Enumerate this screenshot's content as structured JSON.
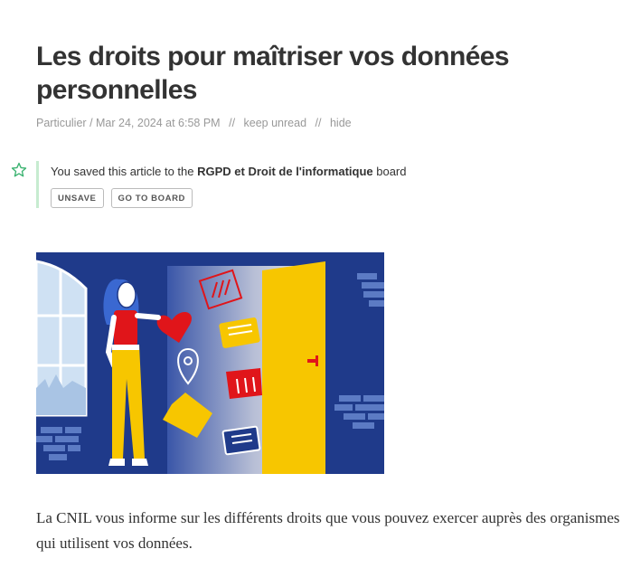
{
  "article": {
    "title": "Les droits pour maîtriser vos données personnelles",
    "source": "Particulier",
    "date": "Mar 24, 2024 at 6:58 PM",
    "separator": "//",
    "keep_unread_label": "keep unread",
    "hide_label": "hide",
    "body": "La CNIL vous informe sur les différents droits que vous pouvez exercer auprès des organismes qui utilisent vos données."
  },
  "saved": {
    "prefix": "You saved this article to the ",
    "board_name": "RGPD et Droit de l'informatique",
    "suffix": " board",
    "unsave_label": "UNSAVE",
    "go_to_board_label": "GO TO BOARD"
  },
  "icons": {
    "star": "star-outline-icon"
  },
  "colors": {
    "accent_green": "#3cb371",
    "saved_border": "#c7ecd0",
    "illustration_blue": "#1f3a8a",
    "door_yellow": "#f7c600",
    "heart_red": "#e0151a"
  }
}
